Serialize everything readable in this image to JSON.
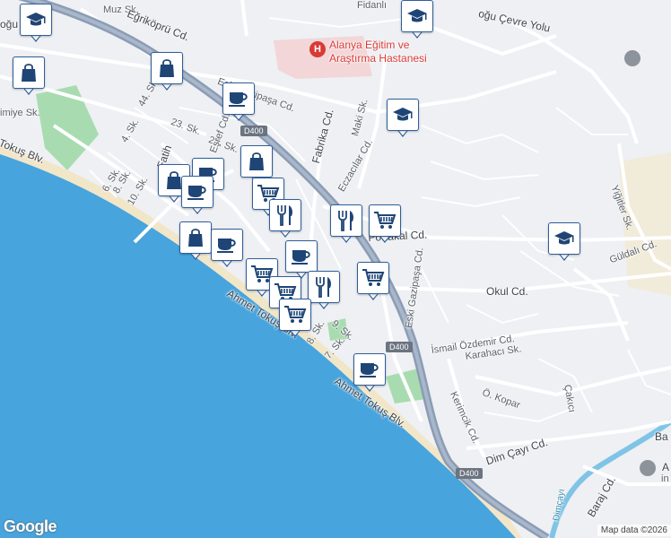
{
  "map": {
    "hospital_name": "Alanya Eğitim ve Araştırma Hastanesi",
    "highway_shield": "D400",
    "street_labels": {
      "muz": "Muz Sk.",
      "egrikopru": "Eğriköprü Cd.",
      "ogu_cevre": "oğu Çevre Yolu",
      "ogu_left": "oğu Cd.",
      "fidanlik": "Fidanlı",
      "sk44": "44. Sk.",
      "imiye": "imiye Sk.",
      "sk23": "23. Sk.",
      "sk27": "27. Sk.",
      "sk4": "4. Sk.",
      "fatih": "Fatih",
      "esref": "Eşref Cd.",
      "eski_gazipasa_top": "Eski Gazipaşa Cd.",
      "fabrika": "Fabrika Cd.",
      "maki": "Maki Sk.",
      "eczacilar": "Eczacılar Cd.",
      "sk6": "6. Sk.",
      "sk8": "8. Sk.",
      "sk10": "10. Sk.",
      "tokus_blv": "Tokuş Blv.",
      "portakal": "Portakal Cd.",
      "eski_gazipasa": "Eski Gazipaşa Cd.",
      "ahmet1": "Ahmet Tokuş Blv.",
      "ahmet2": "Ahmet Tokuş Blv.",
      "sk8b": "8. Sk.",
      "sk7": "7. Sk.",
      "sk9": "9. Sk.",
      "okul": "Okul Cd.",
      "ismail": "İsmail Özdemir Cd.",
      "karahaci": "Karahacı Sk.",
      "kerimcik": "Kerimcik Cd.",
      "kopar": "Ö. Kopar",
      "cakici": "Çakıcı",
      "guldali": "Güldalı Cd.",
      "yigitler": "Yiğitler Sk.",
      "dim_cayi": "Dim Çayı Cd.",
      "barajl": "Baraj Cd.",
      "dimcayi_river": "Dimçayı",
      "right_edge": "Ba",
      "right_edge2": "A",
      "right_edge3": "in"
    },
    "google_logo": "Google",
    "attribution": "Map data ©2026"
  },
  "colors": {
    "sea": "#47a4dd",
    "beach": "#f2e6c9",
    "land": "#eef0f3",
    "road": "#ffffff",
    "highway": "#8b9cb5",
    "park": "#a8dcb0",
    "hospital_area": "#f3d6d8",
    "pin_border": "#2f5f9c",
    "pin_icon": "#1f4576"
  },
  "pins": [
    {
      "icon": "school-icon"
    },
    {
      "icon": "school-icon"
    },
    {
      "icon": "shopping-bag-icon"
    },
    {
      "icon": "shopping-bag-icon"
    },
    {
      "icon": "coffee-icon"
    },
    {
      "icon": "school-icon"
    },
    {
      "icon": "shopping-bag-icon"
    },
    {
      "icon": "coffee-icon"
    },
    {
      "icon": "shopping-bag-icon"
    },
    {
      "icon": "coffee-icon"
    },
    {
      "icon": "cart-icon"
    },
    {
      "icon": "restaurant-icon"
    },
    {
      "icon": "restaurant-icon"
    },
    {
      "icon": "cart-icon"
    },
    {
      "icon": "shopping-bag-icon"
    },
    {
      "icon": "coffee-icon"
    },
    {
      "icon": "coffee-icon"
    },
    {
      "icon": "cart-icon"
    },
    {
      "icon": "cart-icon"
    },
    {
      "icon": "restaurant-icon"
    },
    {
      "icon": "cart-icon"
    },
    {
      "icon": "cart-icon"
    },
    {
      "icon": "coffee-icon"
    },
    {
      "icon": "school-icon"
    }
  ]
}
